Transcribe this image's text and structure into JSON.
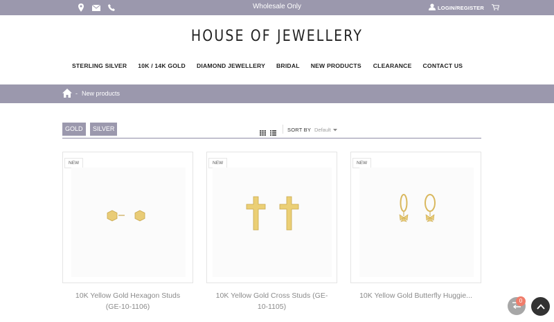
{
  "topbar": {
    "center_text": "Wholesale Only",
    "login_label": "LOGIN/REGISTER",
    "icons": [
      "location-pin-icon",
      "envelope-icon",
      "phone-icon",
      "user-icon",
      "cart-icon"
    ]
  },
  "header": {
    "logo": "HOUSE OF JEWELLERY"
  },
  "nav": {
    "items": [
      {
        "label": "STERLING SILVER"
      },
      {
        "label": "10K / 14K GOLD"
      },
      {
        "label": "DIAMOND JEWELLERY"
      },
      {
        "label": "BRIDAL"
      },
      {
        "label": "NEW PRODUCTS"
      },
      {
        "label": "CLEARANCE"
      },
      {
        "label": "CONTACT US"
      }
    ]
  },
  "breadcrumb": {
    "separator": "-",
    "current": "New products"
  },
  "filters": {
    "gold_label": "GOLD",
    "silver_label": "SILVER"
  },
  "sort": {
    "label": "SORT BY",
    "value": "Default"
  },
  "products": [
    {
      "badge": "NEW",
      "title_line1": "10K Yellow Gold Hexagon Studs",
      "title_line2": "(GE-10-1106)"
    },
    {
      "badge": "NEW",
      "title_line1": "10K Yellow Gold Cross Studs (GE-",
      "title_line2": "10-1105)"
    },
    {
      "badge": "NEW",
      "title_line1": "10K Yellow Gold Butterfly Huggie...",
      "title_line2": ""
    }
  ],
  "compare": {
    "count": "0"
  },
  "colors": {
    "accent": "#9b98ad",
    "gold": "#e2c46a",
    "badge": "#f07d6b"
  }
}
